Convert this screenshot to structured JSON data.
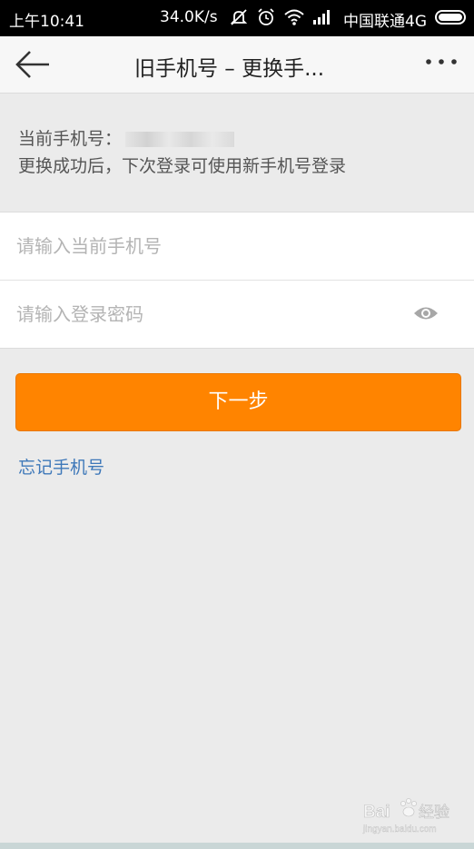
{
  "status_bar": {
    "time": "上午10:41",
    "speed": "34.0K/s",
    "carrier": "中国联通4G"
  },
  "header": {
    "title": "旧手机号 – 更换手..."
  },
  "info": {
    "current_phone_label": "当前手机号：",
    "hint": "更换成功后，下次登录可使用新手机号登录"
  },
  "form": {
    "phone_placeholder": "请输入当前手机号",
    "password_placeholder": "请输入登录密码"
  },
  "next_button": "下一步",
  "forgot_link": "忘记手机号",
  "watermark": {
    "brand": "Baidu",
    "sub": "经验",
    "url": "jingyan.baidu.com"
  }
}
